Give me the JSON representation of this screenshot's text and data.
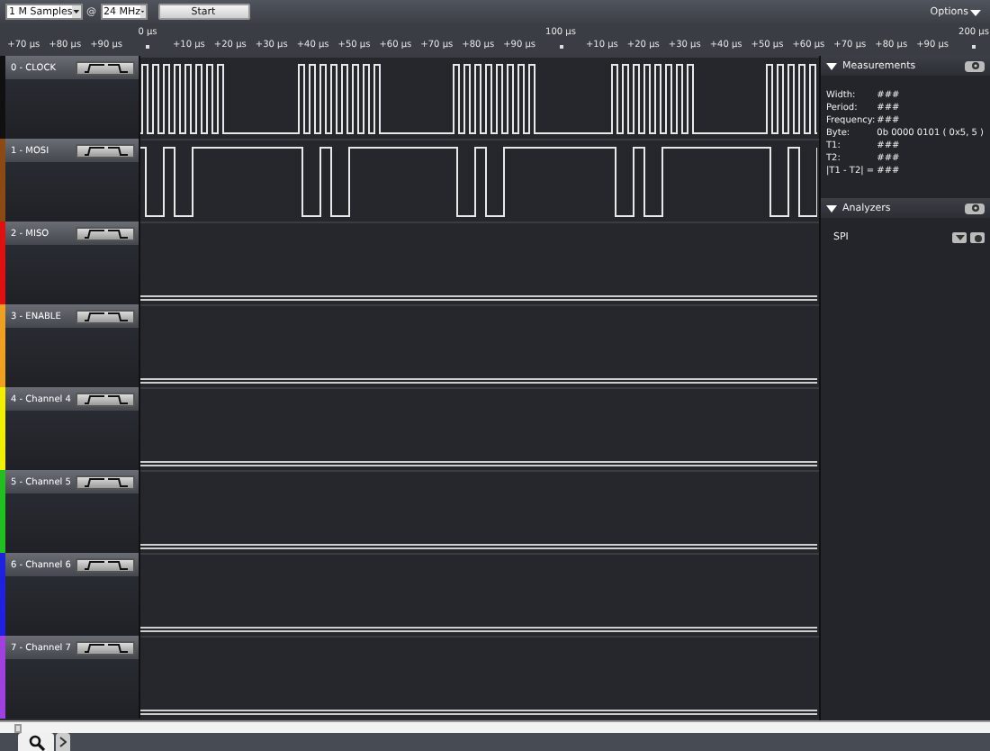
{
  "toolbar": {
    "samples": "1 M Samples",
    "at": "@",
    "rate": "24 MHz",
    "start": "Start",
    "options": "Options"
  },
  "ruler": [
    {
      "text": "+70 µs",
      "kind": "minor"
    },
    {
      "text": "+80 µs",
      "kind": "minor"
    },
    {
      "text": "+90 µs",
      "kind": "minor"
    },
    {
      "text": "0 µs",
      "kind": "major"
    },
    {
      "text": "+10 µs",
      "kind": "minor"
    },
    {
      "text": "+20 µs",
      "kind": "minor"
    },
    {
      "text": "+30 µs",
      "kind": "minor"
    },
    {
      "text": "+40 µs",
      "kind": "minor"
    },
    {
      "text": "+50 µs",
      "kind": "minor"
    },
    {
      "text": "+60 µs",
      "kind": "minor"
    },
    {
      "text": "+70 µs",
      "kind": "minor"
    },
    {
      "text": "+80 µs",
      "kind": "minor"
    },
    {
      "text": "+90 µs",
      "kind": "minor"
    },
    {
      "text": "100 µs",
      "kind": "major"
    },
    {
      "text": "+10 µs",
      "kind": "minor"
    },
    {
      "text": "+20 µs",
      "kind": "minor"
    },
    {
      "text": "+30 µs",
      "kind": "minor"
    },
    {
      "text": "+40 µs",
      "kind": "minor"
    },
    {
      "text": "+50 µs",
      "kind": "minor"
    },
    {
      "text": "+60 µs",
      "kind": "minor"
    },
    {
      "text": "+70 µs",
      "kind": "minor"
    },
    {
      "text": "+80 µs",
      "kind": "minor"
    },
    {
      "text": "+90 µs",
      "kind": "minor"
    },
    {
      "text": "200 µs",
      "kind": "major"
    }
  ],
  "channels": [
    {
      "label": "0 - CLOCK",
      "color": "#101010",
      "kind": "clock"
    },
    {
      "label": "1 - MOSI",
      "color": "#8b4a12",
      "kind": "data"
    },
    {
      "label": "2 - MISO",
      "color": "#e01010",
      "kind": "idle"
    },
    {
      "label": "3 - ENABLE",
      "color": "#f0a020",
      "kind": "idle"
    },
    {
      "label": "4 - Channel 4",
      "color": "#f0f000",
      "kind": "idle"
    },
    {
      "label": "5 - Channel 5",
      "color": "#20c020",
      "kind": "idle"
    },
    {
      "label": "6 - Channel 6",
      "color": "#2020e0",
      "kind": "idle"
    },
    {
      "label": "7 - Channel 7",
      "color": "#a040e0",
      "kind": "idle"
    }
  ],
  "measurements": {
    "title": "Measurements",
    "rows": [
      {
        "label": "Width:",
        "value": "###"
      },
      {
        "label": "Period:",
        "value": "###"
      },
      {
        "label": "Frequency:",
        "value": "###"
      },
      {
        "label": "Byte:",
        "value": "0b 0000 0101 ( 0x5, 5 )"
      },
      {
        "label": "T1:",
        "value": "###"
      },
      {
        "label": "T2:",
        "value": "###"
      },
      {
        "label": "|T1 - T2| =",
        "value": "###"
      }
    ]
  },
  "analyzers": {
    "title": "Analyzers",
    "items": [
      {
        "name": "SPI"
      }
    ]
  }
}
